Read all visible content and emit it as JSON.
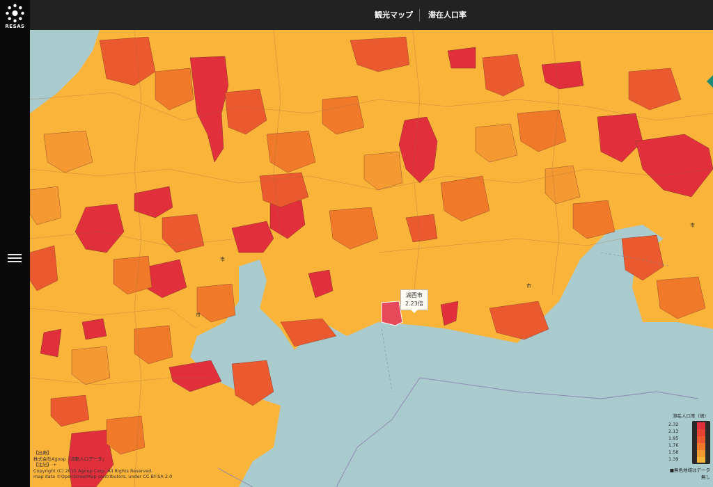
{
  "app": {
    "logo_text": "RESAS"
  },
  "header": {
    "tabs": [
      "観光マップ",
      "滞在人口率"
    ]
  },
  "tooltip": {
    "city": "湖西市",
    "value": "2.23倍"
  },
  "legend": {
    "title": "滞在人口率（倍）",
    "entries": [
      {
        "label": "2.32",
        "color": "#e1303c"
      },
      {
        "label": "2.13",
        "color": "#e54234"
      },
      {
        "label": "1.95",
        "color": "#eb5a2e"
      },
      {
        "label": "1.76",
        "color": "#f07a2a"
      },
      {
        "label": "1.58",
        "color": "#f59a32"
      },
      {
        "label": "1.39",
        "color": "#fbb43a"
      }
    ],
    "nodata_label": "■無色地域はデータ無し"
  },
  "attribution": {
    "line1": "【出典】",
    "line2": "株式会社Agoop「流動人口データ」",
    "line3": "【注記】 +",
    "line4": "Copyright (C) 2015 Agoop Corp. All Rights Reserved.",
    "line5": "map data ©OpenStreetMap contributors, under CC BY-SA 2.0"
  },
  "map_labels": {
    "city_suffix": "市"
  },
  "colors": {
    "sea": "#aacbce",
    "border": "#7a5a3a",
    "accent": "#1a8a7a"
  }
}
